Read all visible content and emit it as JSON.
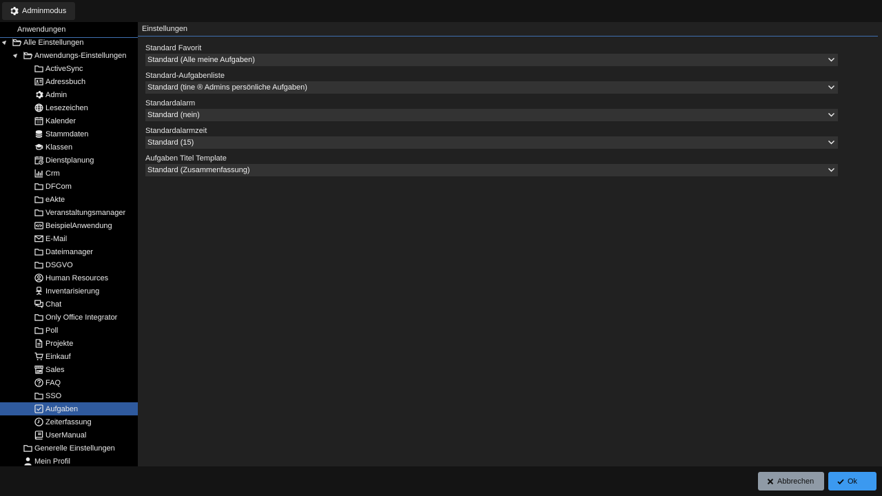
{
  "topbar": {
    "admin_label": "Adminmodus"
  },
  "sidebar": {
    "header": "Anwendungen",
    "root": {
      "label": "Alle Einstellungen",
      "icon": "folder-open-icon"
    },
    "group": {
      "label": "Anwendungs-Einstellungen",
      "icon": "folder-open-icon"
    },
    "apps": [
      {
        "label": "ActiveSync",
        "icon": "folder-icon"
      },
      {
        "label": "Adressbuch",
        "icon": "contact-card-icon"
      },
      {
        "label": "Admin",
        "icon": "gear-icon"
      },
      {
        "label": "Lesezeichen",
        "icon": "globe-icon"
      },
      {
        "label": "Kalender",
        "icon": "calendar-icon"
      },
      {
        "label": "Stammdaten",
        "icon": "database-icon"
      },
      {
        "label": "Klassen",
        "icon": "graduation-cap-icon"
      },
      {
        "label": "Dienstplanung",
        "icon": "calendar-clock-icon"
      },
      {
        "label": "Crm",
        "icon": "bar-chart-icon"
      },
      {
        "label": "DFCom",
        "icon": "folder-icon"
      },
      {
        "label": "eAkte",
        "icon": "folder-icon"
      },
      {
        "label": "Veranstaltungsmanager",
        "icon": "folder-icon"
      },
      {
        "label": "BeispielAnwendung",
        "icon": "code-window-icon"
      },
      {
        "label": "E-Mail",
        "icon": "envelope-icon"
      },
      {
        "label": "Dateimanager",
        "icon": "folder-icon"
      },
      {
        "label": "DSGVO",
        "icon": "folder-icon"
      },
      {
        "label": "Human Resources",
        "icon": "user-circle-icon"
      },
      {
        "label": "Inventarisierung",
        "icon": "office-chair-icon"
      },
      {
        "label": "Chat",
        "icon": "chat-icon"
      },
      {
        "label": "Only Office Integrator",
        "icon": "folder-icon"
      },
      {
        "label": "Poll",
        "icon": "folder-icon"
      },
      {
        "label": "Projekte",
        "icon": "document-icon"
      },
      {
        "label": "Einkauf",
        "icon": "shopping-cart-icon"
      },
      {
        "label": "Sales",
        "icon": "store-icon"
      },
      {
        "label": "FAQ",
        "icon": "question-circle-icon"
      },
      {
        "label": "SSO",
        "icon": "folder-icon"
      },
      {
        "label": "Aufgaben",
        "icon": "checkbox-icon",
        "selected": true
      },
      {
        "label": "Zeiterfassung",
        "icon": "clock-icon"
      },
      {
        "label": "UserManual",
        "icon": "book-icon"
      }
    ],
    "general": {
      "label": "Generelle Einstellungen",
      "icon": "folder-icon"
    },
    "profile": {
      "label": "Mein Profil",
      "icon": "user-icon"
    }
  },
  "main": {
    "header": "Einstellungen",
    "fields": [
      {
        "label": "Standard Favorit",
        "value": "Standard (Alle meine Aufgaben)"
      },
      {
        "label": "Standard-Aufgabenliste",
        "value": "Standard (tine ® Admins persönliche Aufgaben)"
      },
      {
        "label": "Standardalarm",
        "value": "Standard (nein)"
      },
      {
        "label": "Standardalarmzeit",
        "value": "Standard (15)"
      },
      {
        "label": "Aufgaben Titel Template",
        "value": "Standard (Zusammenfassung)"
      }
    ]
  },
  "footer": {
    "cancel_label": "Abbrechen",
    "ok_label": "Ok"
  },
  "colors": {
    "accent": "#3b99f0",
    "selection": "#2f5a9e",
    "panel": "#212121",
    "sidebar": "#000000"
  }
}
